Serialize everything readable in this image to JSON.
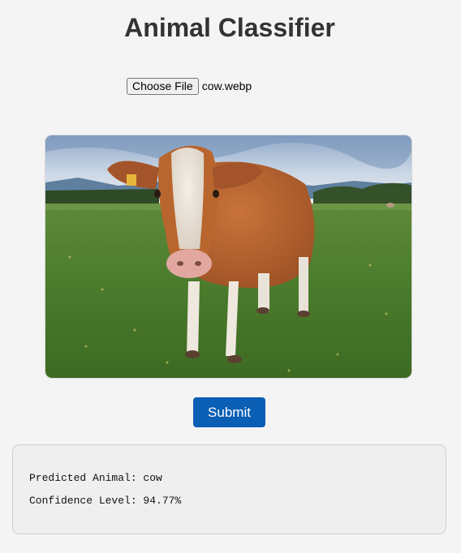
{
  "page": {
    "title": "Animal Classifier"
  },
  "upload": {
    "button_label": "Choose File",
    "file_name": "cow.webp"
  },
  "preview": {
    "alt": "cow.webp preview"
  },
  "actions": {
    "submit_label": "Submit"
  },
  "result": {
    "predicted_label": "Predicted Animal: cow",
    "confidence_label": "Confidence Level: 94.77%"
  },
  "colors": {
    "background": "#f4f4f4",
    "accent": "#0a5fb4",
    "result_bg": "#efefef"
  }
}
